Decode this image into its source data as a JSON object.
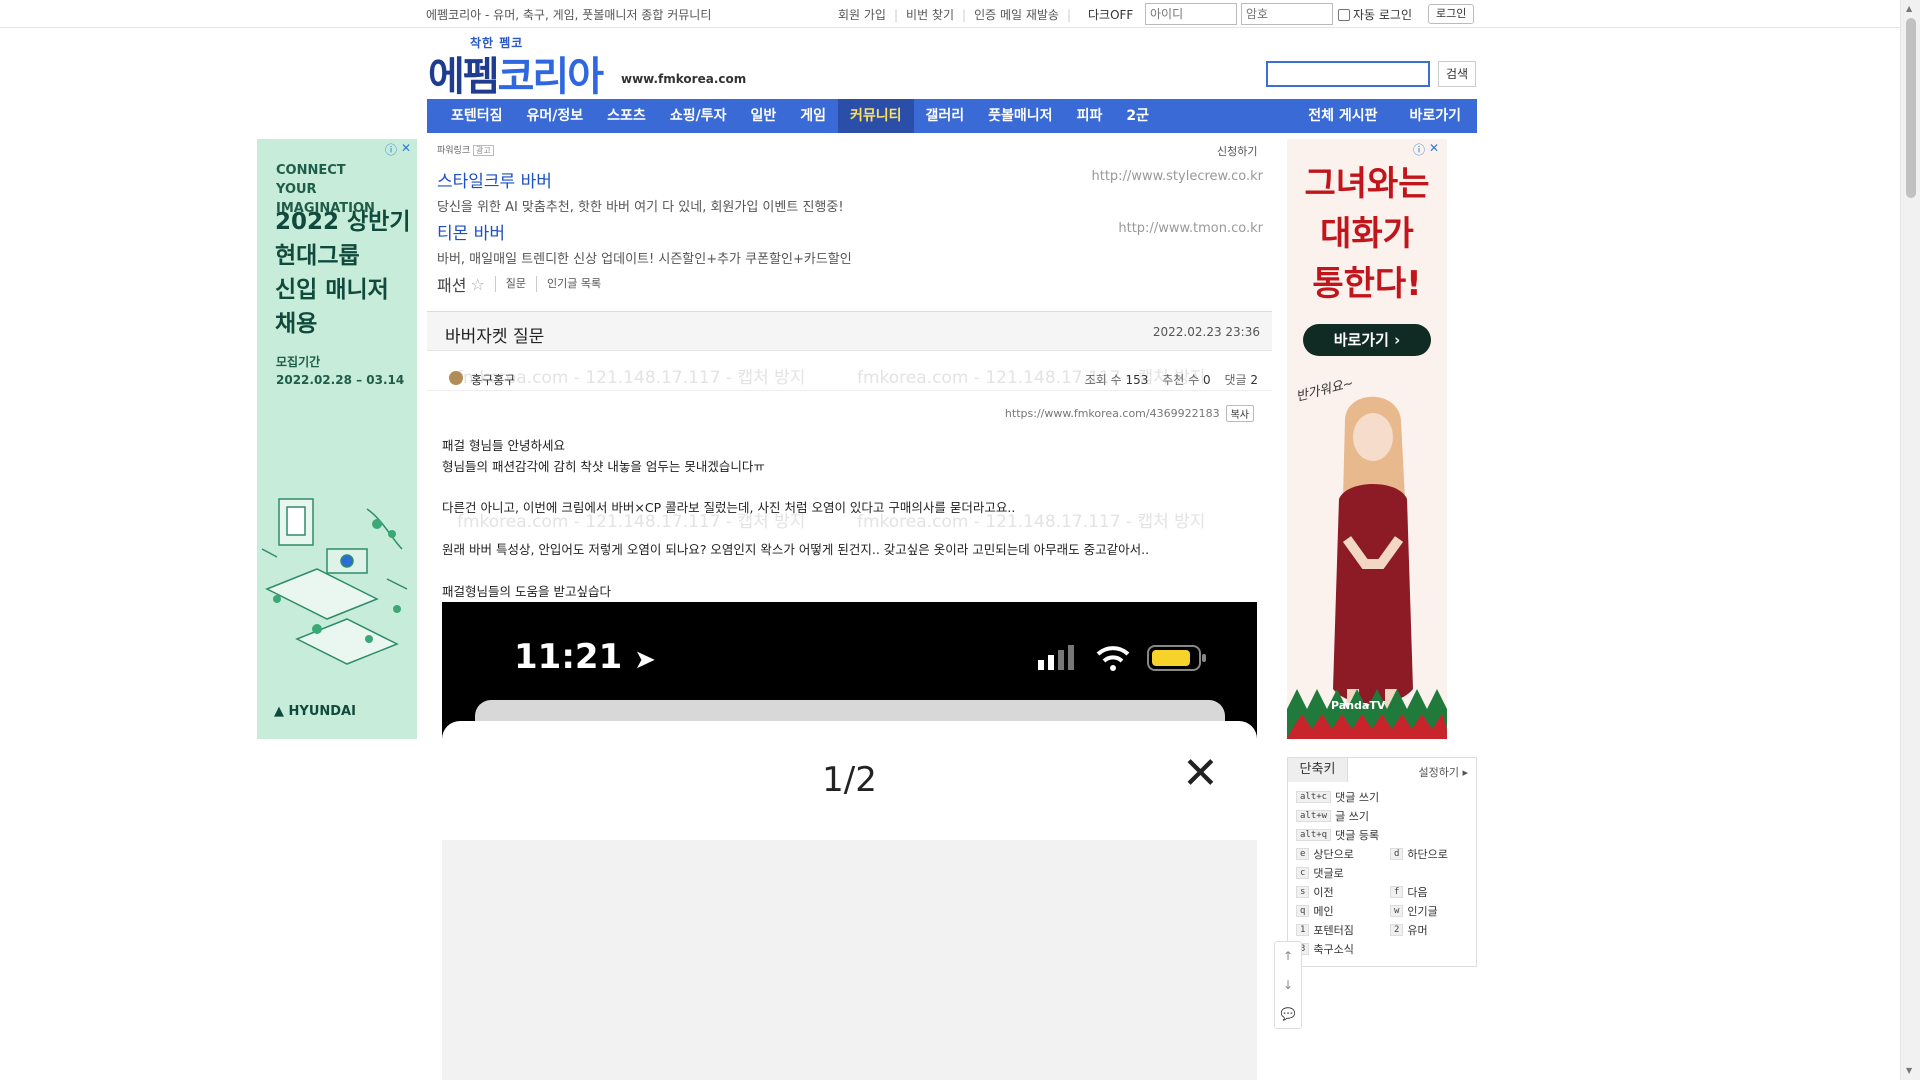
{
  "topbar": {
    "tagline": "에펨코리아 - 유머, 축구, 게임, 풋볼매니저 종합 커뮤니티",
    "links": [
      "회원 가입",
      "비번 찾기",
      "인증 메일 재발송"
    ],
    "dark_toggle": "다크OFF",
    "id_placeholder": "아이디",
    "pw_placeholder": "암호",
    "auto_login": "자동 로그인",
    "login_button": "로그인"
  },
  "header": {
    "logo_small": "착한 펨코",
    "logo_big_a": "에펨",
    "logo_big_b": "코리아",
    "url": "www.fmkorea.com",
    "search_button": "검색"
  },
  "nav": {
    "items": [
      "포텐터짐",
      "유머/정보",
      "스포츠",
      "쇼핑/투자",
      "일반",
      "게임",
      "커뮤니티",
      "갤러리",
      "풋볼매니저",
      "피파",
      "2군"
    ],
    "right": [
      "전체 게시판",
      "바로가기"
    ]
  },
  "ad_left": {
    "line1": "CONNECT",
    "line2": "YOUR IMAGINATION",
    "head1": "2022 상반기",
    "head2": "현대그룹",
    "head3": "신입 매니저",
    "head4": "채용",
    "period_label": "모집기간",
    "period": "2022.02.28 – 03.14",
    "brand": "HYUNDAI"
  },
  "ad_right": {
    "head1": "그녀와는",
    "head2": "대화가",
    "head3": "통한다!",
    "button": "바로가기",
    "handwriting": "반가워요~",
    "brand": "PandaTV"
  },
  "powerlink": {
    "label": "파워링크",
    "ad_badge": "광고",
    "apply": "신청하기",
    "items": [
      {
        "title": "스타일크루 바버",
        "desc": "당신을 위한 AI 맞춤추천, 핫한 바버 여기 다 있네, 회원가입 이벤트 진행중!",
        "url": "http://www.stylecrew.co.kr"
      },
      {
        "title": "티몬 바버",
        "desc": "바버, 매일매일 트렌디한 신상 업데이트! 시즌할인+추가 쿠폰할인+카드할인",
        "url": "http://www.tmon.co.kr"
      }
    ]
  },
  "board": {
    "category": "패션",
    "subs": [
      "질문",
      "인기글 목록"
    ]
  },
  "post": {
    "title": "바버자켓 질문",
    "datetime": "2022.02.23 23:36",
    "author": "홍구홍구",
    "views_label": "조회 수",
    "views": "153",
    "likes_label": "추천 수",
    "likes": "0",
    "comments_label": "댓글",
    "comments": "2",
    "permalink": "https://www.fmkorea.com/4369922183",
    "copy": "복사",
    "watermark": "fmkorea.com - 121.148.17.117 - 캡처 방지",
    "lines": [
      "패걸 형님들 안녕하세요",
      "형님들의 패션감각에 감히 착샷 내놓을 엄두는 못내겠습니다ㅠ",
      "",
      "다른건 아니고, 이번에 크림에서 바버×CP 콜라보 질렀는데, 사진 처럼 오염이 있다고 구매의사를 묻더라고요..",
      "",
      "원래 바버 특성상, 안입어도 저렇게 오염이 되나요? 오염인지 왁스가 어떻게 된건지.. 갖고싶은 옷이라 고민되는데 아무래도 중고같아서..",
      "",
      "패걸형님들의 도움을 받고싶습다"
    ],
    "screenshot_time": "11:21",
    "screenshot_counter": "1/2"
  },
  "shortcuts": {
    "tab": "단축키",
    "setting": "설정하기",
    "items": [
      {
        "key": "alt+c",
        "label": "댓글 쓰기"
      },
      {
        "key": "alt+w",
        "label": "글 쓰기"
      },
      {
        "key": "alt+q",
        "label": "댓글 등록"
      },
      {
        "key": "e",
        "label": "상단으로"
      },
      {
        "key": "d",
        "label": "하단으로"
      },
      {
        "key": "c",
        "label": "댓글로"
      },
      {
        "key": "s",
        "label": "이전"
      },
      {
        "key": "f",
        "label": "다음"
      },
      {
        "key": "q",
        "label": "메인"
      },
      {
        "key": "w",
        "label": "인기글"
      },
      {
        "key": "1",
        "label": "포텐터짐"
      },
      {
        "key": "2",
        "label": "유머"
      },
      {
        "key": "3",
        "label": "축구소식"
      }
    ]
  },
  "colors": {
    "nav": "#3a6ad5",
    "nav_active_text": "#ffe15a",
    "link": "#1d4fc6"
  }
}
